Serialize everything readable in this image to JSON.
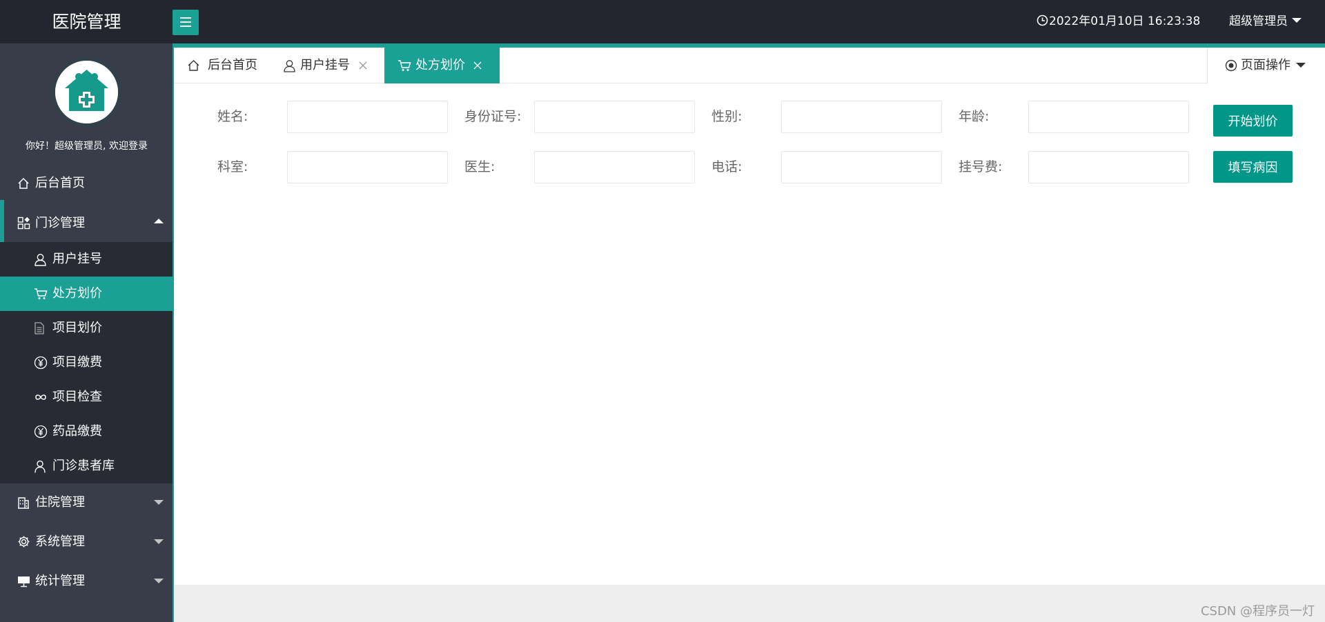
{
  "app": {
    "title": "医院管理"
  },
  "header": {
    "datetime": "2022年01月10日 16:23:38",
    "user": "超级管理员"
  },
  "sidebar": {
    "welcome": "你好！超级管理员, 欢迎登录",
    "home": "后台首页",
    "outpatient": {
      "label": "门诊管理",
      "items": [
        {
          "label": "用户挂号",
          "icon": "user-icon"
        },
        {
          "label": "处方划价",
          "icon": "cart-icon"
        },
        {
          "label": "项目划价",
          "icon": "document-icon"
        },
        {
          "label": "项目缴费",
          "icon": "yuan-icon"
        },
        {
          "label": "项目检查",
          "icon": "infinity-icon"
        },
        {
          "label": "药品缴费",
          "icon": "yuan-icon"
        },
        {
          "label": "门诊患者库",
          "icon": "person-icon"
        }
      ]
    },
    "inpatient": "住院管理",
    "system": "系统管理",
    "statistics": "统计管理"
  },
  "tabs": {
    "home": "后台首页",
    "register": "用户挂号",
    "prescription": "处方划价",
    "page_ops": "页面操作"
  },
  "form": {
    "name_label": "姓名:",
    "id_label": "身份证号:",
    "gender_label": "性别:",
    "age_label": "年龄:",
    "dept_label": "科室:",
    "doctor_label": "医生:",
    "phone_label": "电话:",
    "fee_label": "挂号费:",
    "start_button": "开始划价",
    "cause_button": "填写病因"
  },
  "footer": {
    "watermark": "CSDN @程序员一灯"
  },
  "colors": {
    "header": "#23262e",
    "sidebar": "#393d49",
    "accent": "#1aa094",
    "button": "#009688"
  }
}
